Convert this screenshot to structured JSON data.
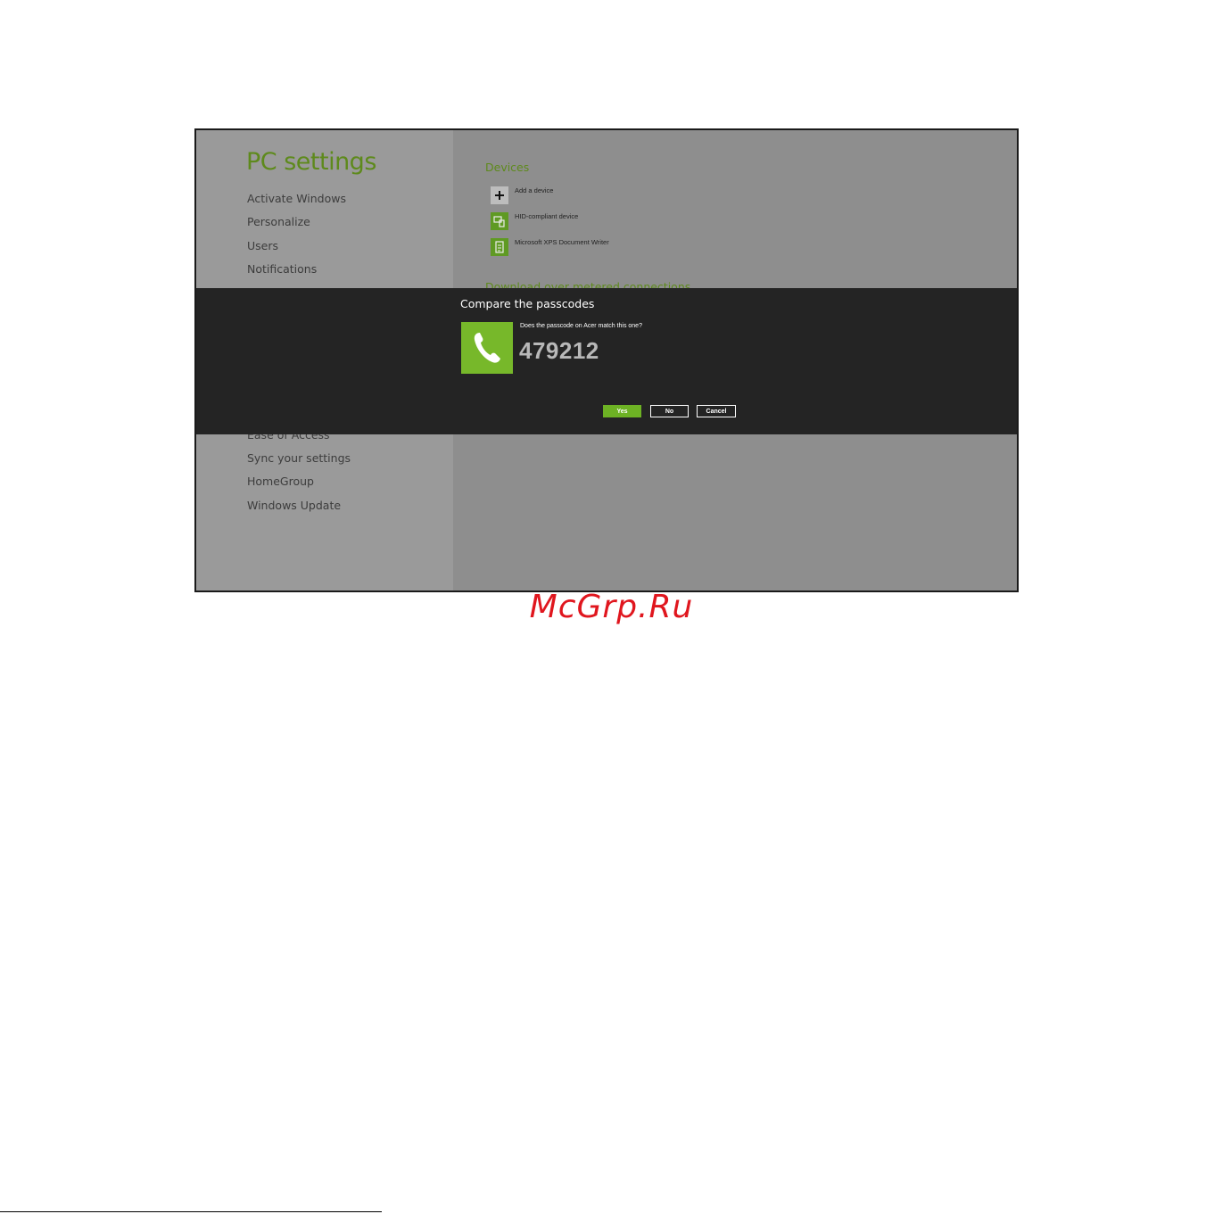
{
  "pc_settings": {
    "title": "PC settings",
    "menu_top": [
      "Activate Windows",
      "Personalize",
      "Users",
      "Notifications"
    ],
    "menu_bottom": [
      "Ease of Access",
      "Sync your settings",
      "HomeGroup",
      "Windows Update"
    ]
  },
  "devices": {
    "section_title": "Devices",
    "items": [
      {
        "label": "Add a device",
        "icon": "plus-icon"
      },
      {
        "label": "HID-compliant device",
        "icon": "hid-device-icon"
      },
      {
        "label": "Microsoft XPS Document Writer",
        "icon": "printer-icon"
      }
    ],
    "section_title_2": "Download over metered connections"
  },
  "dialog": {
    "title": "Compare the passcodes",
    "question": "Does the passcode on Acer match this one?",
    "passcode": "479212",
    "icon": "phone-icon",
    "buttons": {
      "yes": "Yes",
      "no": "No",
      "cancel": "Cancel"
    }
  },
  "colors": {
    "accent_green": "#77b82a",
    "title_green": "#5e8a1c",
    "dialog_bg": "#242424"
  },
  "watermark": "McGrp.Ru"
}
